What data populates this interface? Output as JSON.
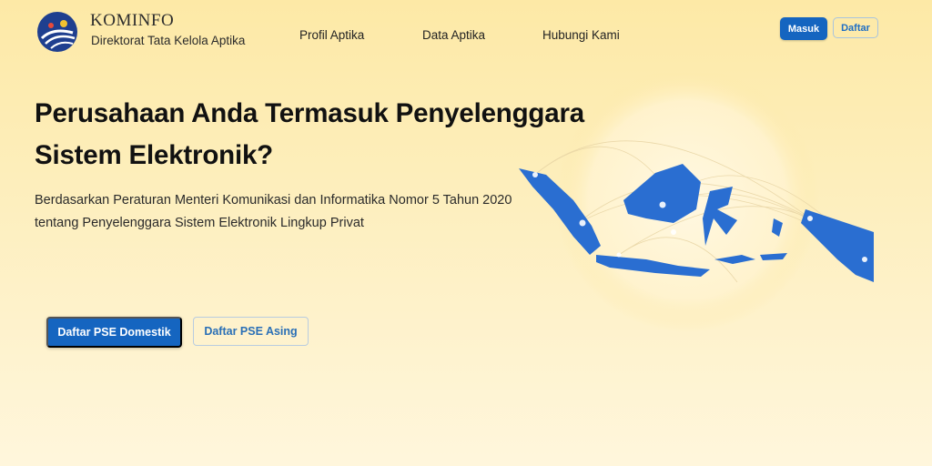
{
  "brand": {
    "name": "KOMINFO",
    "subtitle": "Direktorat Tata Kelola Aptika"
  },
  "nav": {
    "links": [
      "Profil Aptika",
      "Data Aptika",
      "Hubungi Kami"
    ],
    "login_label": "Masuk",
    "register_label": "Daftar"
  },
  "hero": {
    "title_line1": "Perusahaan Anda Termasuk Penyelenggara",
    "title_line2": "Sistem Elektronik?",
    "desc_line1": "Berdasarkan Peraturan Menteri Komunikasi dan Informatika Nomor 5 Tahun 2020",
    "desc_line2": "tentang Penyelenggara Sistem Elektronik Lingkup Privat",
    "cta_primary": "Daftar PSE Domestik",
    "cta_secondary": "Daftar PSE Asing"
  },
  "colors": {
    "primary": "#1565c0",
    "map_blue": "#2a6ed1",
    "background": "#fde9a6"
  }
}
